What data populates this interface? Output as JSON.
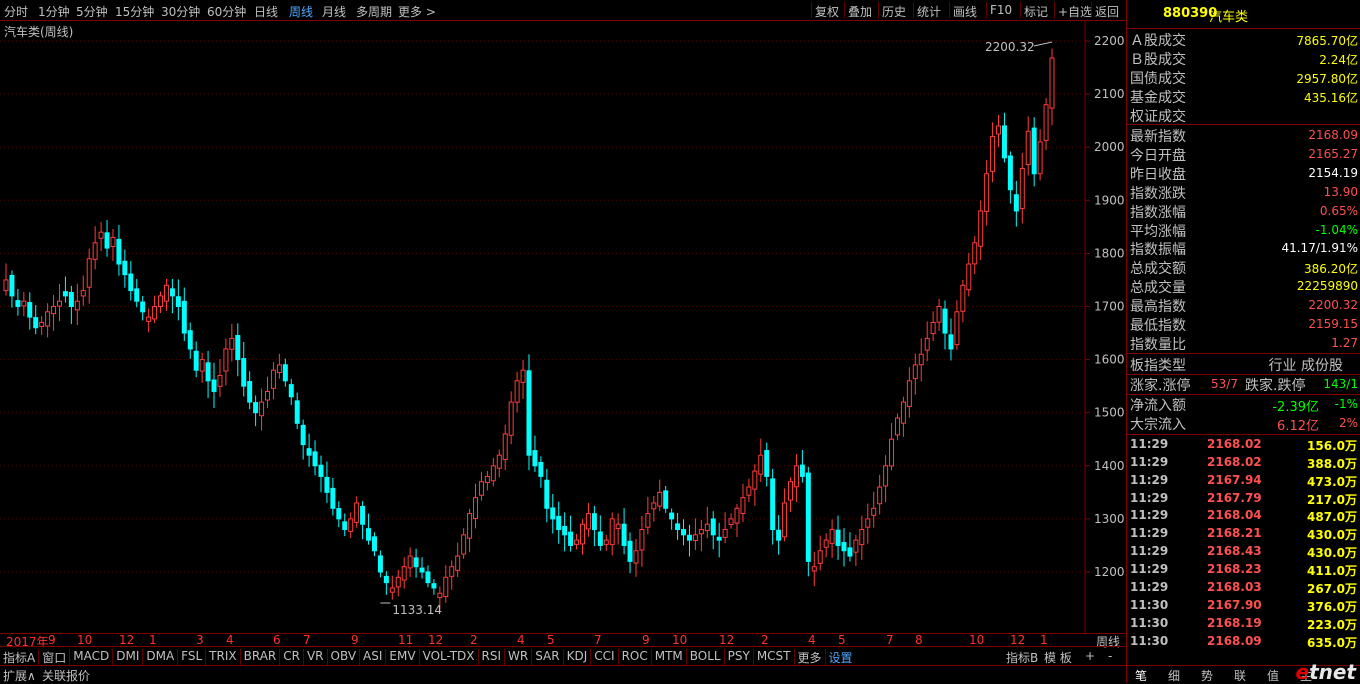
{
  "periods": [
    "分时",
    "1分钟",
    "5分钟",
    "15分钟",
    "30分钟",
    "60分钟",
    "日线",
    "周线",
    "月线",
    "多周期",
    "更多 >"
  ],
  "active_period": "周线",
  "tools": [
    "复权",
    "叠加",
    "历史",
    "统计",
    "画线",
    "F10",
    "标记",
    "+自选",
    "返回"
  ],
  "chart_title": "汽车类(周线)",
  "high_label": "2200.32",
  "low_label": "1133.14",
  "weekly_label": "周线",
  "colors": {
    "up": "#ff3c3c",
    "down": "#00ffff",
    "grid": "#800000",
    "axis_text": "#c0c0c0",
    "yellow": "#ffff00",
    "green": "#00ff00"
  },
  "chart_data": {
    "type": "candlestick",
    "y_ticks": [
      1200,
      1300,
      1400,
      1500,
      1600,
      1700,
      1800,
      1900,
      2000,
      2100,
      2200
    ],
    "ylim": [
      1100,
      2250
    ],
    "x_labels": [
      {
        "label": "2017年",
        "i": 0
      },
      {
        "label": "9",
        "i": 7
      },
      {
        "label": "10",
        "i": 12
      },
      {
        "label": "12",
        "i": 19
      },
      {
        "label": "1",
        "i": 24
      },
      {
        "label": "3",
        "i": 32
      },
      {
        "label": "4",
        "i": 37
      },
      {
        "label": "6",
        "i": 45
      },
      {
        "label": "7",
        "i": 50
      },
      {
        "label": "9",
        "i": 58
      },
      {
        "label": "11",
        "i": 66
      },
      {
        "label": "12",
        "i": 71
      },
      {
        "label": "2",
        "i": 78
      },
      {
        "label": "4",
        "i": 86
      },
      {
        "label": "5",
        "i": 91
      },
      {
        "label": "7",
        "i": 99
      },
      {
        "label": "9",
        "i": 107
      },
      {
        "label": "10",
        "i": 112
      },
      {
        "label": "12",
        "i": 120
      },
      {
        "label": "2",
        "i": 127
      },
      {
        "label": "4",
        "i": 135
      },
      {
        "label": "5",
        "i": 140
      },
      {
        "label": "7",
        "i": 148
      },
      {
        "label": "8",
        "i": 153
      },
      {
        "label": "10",
        "i": 162
      },
      {
        "label": "12",
        "i": 169
      },
      {
        "label": "1",
        "i": 174
      }
    ],
    "closes": [
      1750,
      1720,
      1700,
      1710,
      1680,
      1660,
      1670,
      1690,
      1700,
      1710,
      1720,
      1700,
      1710,
      1730,
      1790,
      1820,
      1840,
      1810,
      1830,
      1780,
      1760,
      1730,
      1710,
      1690,
      1680,
      1700,
      1720,
      1740,
      1720,
      1700,
      1650,
      1620,
      1580,
      1600,
      1560,
      1540,
      1570,
      1620,
      1640,
      1600,
      1550,
      1520,
      1500,
      1520,
      1540,
      1580,
      1590,
      1560,
      1530,
      1480,
      1440,
      1420,
      1400,
      1380,
      1350,
      1320,
      1300,
      1280,
      1300,
      1330,
      1290,
      1260,
      1240,
      1200,
      1180,
      1170,
      1190,
      1210,
      1230,
      1210,
      1200,
      1180,
      1170,
      1160,
      1190,
      1210,
      1230,
      1270,
      1310,
      1340,
      1370,
      1380,
      1400,
      1420,
      1460,
      1520,
      1560,
      1580,
      1420,
      1400,
      1380,
      1320,
      1300,
      1280,
      1270,
      1250,
      1260,
      1290,
      1310,
      1280,
      1250,
      1260,
      1300,
      1290,
      1250,
      1220,
      1240,
      1280,
      1310,
      1330,
      1350,
      1320,
      1300,
      1280,
      1270,
      1260,
      1270,
      1280,
      1290,
      1270,
      1260,
      1280,
      1300,
      1320,
      1340,
      1360,
      1390,
      1420,
      1380,
      1280,
      1260,
      1330,
      1370,
      1400,
      1380,
      1220,
      1210,
      1240,
      1260,
      1280,
      1250,
      1240,
      1230,
      1260,
      1280,
      1300,
      1320,
      1360,
      1400,
      1450,
      1490,
      1520,
      1560,
      1590,
      1610,
      1640,
      1670,
      1700,
      1650,
      1620,
      1690,
      1740,
      1780,
      1820,
      1880,
      1950,
      2020,
      2040,
      1980,
      1920,
      1880,
      1960,
      2030,
      1950,
      2010,
      2080,
      2168
    ]
  },
  "panel": {
    "code": "880390",
    "name": "汽车类",
    "rows": [
      {
        "label": "Ａ股成交",
        "value": "7865.70亿",
        "color": "#ffff00"
      },
      {
        "label": "Ｂ股成交",
        "value": "2.24亿",
        "color": "#ffff00"
      },
      {
        "label": "国债成交",
        "value": "2957.80亿",
        "color": "#ffff00"
      },
      {
        "label": "基金成交",
        "value": "435.16亿",
        "color": "#ffff00"
      },
      {
        "label": "权证成交",
        "value": "",
        "color": "#ffff00"
      }
    ],
    "quote": [
      {
        "label": "最新指数",
        "value": "2168.09",
        "color": "#ff5050"
      },
      {
        "label": "今日开盘",
        "value": "2165.27",
        "color": "#ff5050"
      },
      {
        "label": "昨日收盘",
        "value": "2154.19",
        "color": "#ffffff"
      },
      {
        "label": "指数涨跌",
        "value": "13.90",
        "color": "#ff5050"
      },
      {
        "label": "指数涨幅",
        "value": "0.65%",
        "color": "#ff5050"
      },
      {
        "label": "平均涨幅",
        "value": "-1.04%",
        "color": "#00ff00"
      },
      {
        "label": "指数振幅",
        "value": "41.17/1.91%",
        "color": "#ffffff"
      },
      {
        "label": "总成交额",
        "value": "386.20亿",
        "color": "#ffff00"
      },
      {
        "label": "总成交量",
        "value": "22259890",
        "color": "#ffff00"
      },
      {
        "label": "最高指数",
        "value": "2200.32",
        "color": "#ff5050"
      },
      {
        "label": "最低指数",
        "value": "2159.15",
        "color": "#ff5050"
      },
      {
        "label": "指数量比",
        "value": "1.27",
        "color": "#ff5050"
      }
    ],
    "type_label": "板指类型",
    "type_value": "行业 成份股",
    "rise_label": "涨家.涨停",
    "rise_value": "53/7",
    "fall_label": "跌家.跌停",
    "fall_value": "143/1",
    "netflow_label": "净流入额",
    "netflow_value": "-2.39亿",
    "netflow_pct": "-1%",
    "bigflow_label": "大宗流入",
    "bigflow_value": "6.12亿",
    "bigflow_pct": "2%",
    "ticks": [
      {
        "time": "11:29",
        "price": "2168.02",
        "vol": "156.0万"
      },
      {
        "time": "11:29",
        "price": "2168.02",
        "vol": "388.0万"
      },
      {
        "time": "11:29",
        "price": "2167.94",
        "vol": "473.0万"
      },
      {
        "time": "11:29",
        "price": "2167.79",
        "vol": "217.0万"
      },
      {
        "time": "11:29",
        "price": "2168.04",
        "vol": "487.0万"
      },
      {
        "time": "11:29",
        "price": "2168.21",
        "vol": "430.0万"
      },
      {
        "time": "11:29",
        "price": "2168.43",
        "vol": "430.0万"
      },
      {
        "time": "11:29",
        "price": "2168.23",
        "vol": "411.0万"
      },
      {
        "time": "11:29",
        "price": "2168.03",
        "vol": "267.0万"
      },
      {
        "time": "11:30",
        "price": "2167.90",
        "vol": "376.0万"
      },
      {
        "time": "11:30",
        "price": "2168.19",
        "vol": "223.0万"
      },
      {
        "time": "11:30",
        "price": "2168.09",
        "vol": "635.0万"
      }
    ],
    "bottom_tabs": [
      "笔",
      "细",
      "势",
      "联",
      "值",
      "主"
    ]
  },
  "indicator_tabs": [
    "指标A",
    "窗口",
    "MACD",
    "DMI",
    "DMA",
    "FSL",
    "TRIX",
    "BRAR",
    "CR",
    "VR",
    "OBV",
    "ASI",
    "EMV",
    "VOL-TDX",
    "RSI",
    "WR",
    "SAR",
    "KDJ",
    "CCI",
    "ROC",
    "MTM",
    "BOLL",
    "PSY",
    "MCST",
    "更多",
    "设置"
  ],
  "active_indicator": "设置",
  "right_tabs": [
    "指标B",
    "模 板",
    "+",
    "-"
  ],
  "status_tabs": [
    "扩展∧",
    "关联报价"
  ],
  "watermark": "etnet"
}
